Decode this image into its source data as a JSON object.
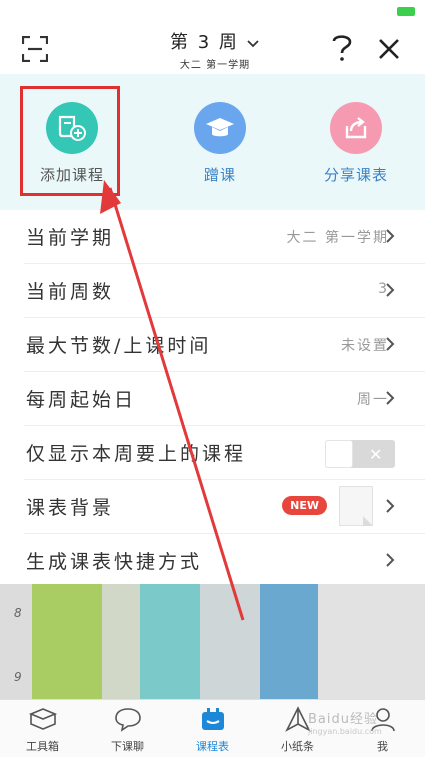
{
  "header": {
    "week_title": "第 3 周",
    "semester": "大二 第一学期"
  },
  "actions": [
    {
      "label": "添加课程",
      "icon": "book-add-icon"
    },
    {
      "label": "蹭课",
      "icon": "graduation-cap-icon"
    },
    {
      "label": "分享课表",
      "icon": "share-icon"
    }
  ],
  "settings": {
    "current_semester": {
      "label": "当前学期",
      "value": "大二 第一学期"
    },
    "current_week": {
      "label": "当前周数",
      "value": "3"
    },
    "max_periods": {
      "label": "最大节数/上课时间",
      "value": "未设置"
    },
    "week_start": {
      "label": "每周起始日",
      "value": "周一"
    },
    "only_this_week": {
      "label": "仅显示本周要上的课程",
      "enabled": false
    },
    "background": {
      "label": "课表背景",
      "badge": "NEW"
    },
    "shortcut": {
      "label": "生成课表快捷方式"
    }
  },
  "timetable": {
    "hours": [
      "8",
      "9"
    ]
  },
  "tabs": [
    {
      "label": "工具箱",
      "icon": "toolbox-icon"
    },
    {
      "label": "下课聊",
      "icon": "chat-bubble-icon"
    },
    {
      "label": "课程表",
      "icon": "schedule-icon",
      "active": true
    },
    {
      "label": "小纸条",
      "icon": "paper-plane-icon"
    },
    {
      "label": "我",
      "icon": "profile-icon"
    }
  ],
  "watermark": {
    "text": "Baidu经验",
    "sub": "jingyan.baidu.com"
  },
  "colors": {
    "accent": "#1e88d8",
    "panel_bg": "#eaf8fa",
    "annotation": "#e03030"
  }
}
